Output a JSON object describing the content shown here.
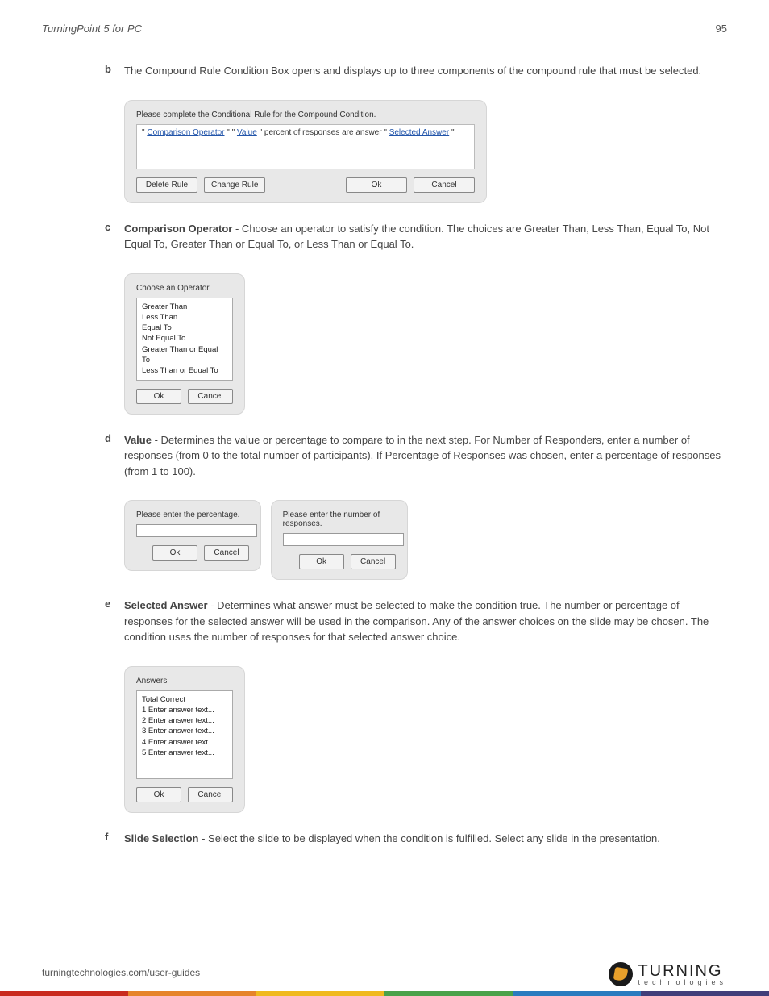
{
  "header": {
    "title": "TurningPoint 5 for PC",
    "page": "95"
  },
  "items": {
    "b": {
      "letter": "b",
      "text": "The Compound Rule Condition Box opens and displays up to three components of the compound rule that must be selected."
    },
    "c": {
      "letter": "c",
      "label": "Comparison Operator",
      "text": " - Choose an operator to satisfy the condition. The choices are Greater Than, Less Than, Equal To, Not Equal To, Greater Than or Equal To, or Less Than or Equal To."
    },
    "d": {
      "letter": "d",
      "label": "Value",
      "text": " - Determines the value or percentage to compare to in the next step. For Number of Responders, enter a number of responses (from 0 to the total number of participants). If Percentage of Responses was chosen, enter a percentage of responses (from 1 to 100)."
    },
    "e": {
      "letter": "e",
      "label": "Selected Answer",
      "text": " - Determines what answer must be selected to make the condition true. The number or percentage of responses for the selected answer will be used in the comparison. Any of the answer choices on the slide may be chosen. The condition uses the number of responses for that selected answer choice."
    },
    "f": {
      "letter": "f",
      "label": "Slide Selection",
      "text": " - Select the slide to be displayed when the condition is fulfilled. Select any slide in the presentation."
    }
  },
  "dialog_rule": {
    "title": "Please complete the Conditional Rule for the Compound Condition.",
    "link1": "Comparison Operator",
    "link2": "Value",
    "mid": "  percent of responses are answer ",
    "link3": "Selected Answer",
    "btn_delete": "Delete Rule",
    "btn_change": "Change Rule",
    "btn_ok": "Ok",
    "btn_cancel": "Cancel"
  },
  "dialog_operator": {
    "title": "Choose an Operator",
    "options": [
      "Greater Than",
      "Less Than",
      "Equal To",
      "Not Equal To",
      "Greater Than or Equal To",
      "Less Than or Equal To"
    ],
    "btn_ok": "Ok",
    "btn_cancel": "Cancel"
  },
  "dialog_percentage": {
    "title": "Please enter the percentage.",
    "btn_ok": "Ok",
    "btn_cancel": "Cancel"
  },
  "dialog_responses": {
    "title": "Please enter the number of responses.",
    "btn_ok": "Ok",
    "btn_cancel": "Cancel"
  },
  "dialog_answers": {
    "title": "Answers",
    "options": [
      "Total Correct",
      "1 Enter answer text...",
      "2 Enter answer text...",
      "3 Enter answer text...",
      "4 Enter answer text...",
      "5 Enter answer text..."
    ],
    "btn_ok": "Ok",
    "btn_cancel": "Cancel"
  },
  "footer": {
    "url": "turningtechnologies.com/user-guides",
    "brand": "TURNING",
    "sub": "technologies"
  }
}
